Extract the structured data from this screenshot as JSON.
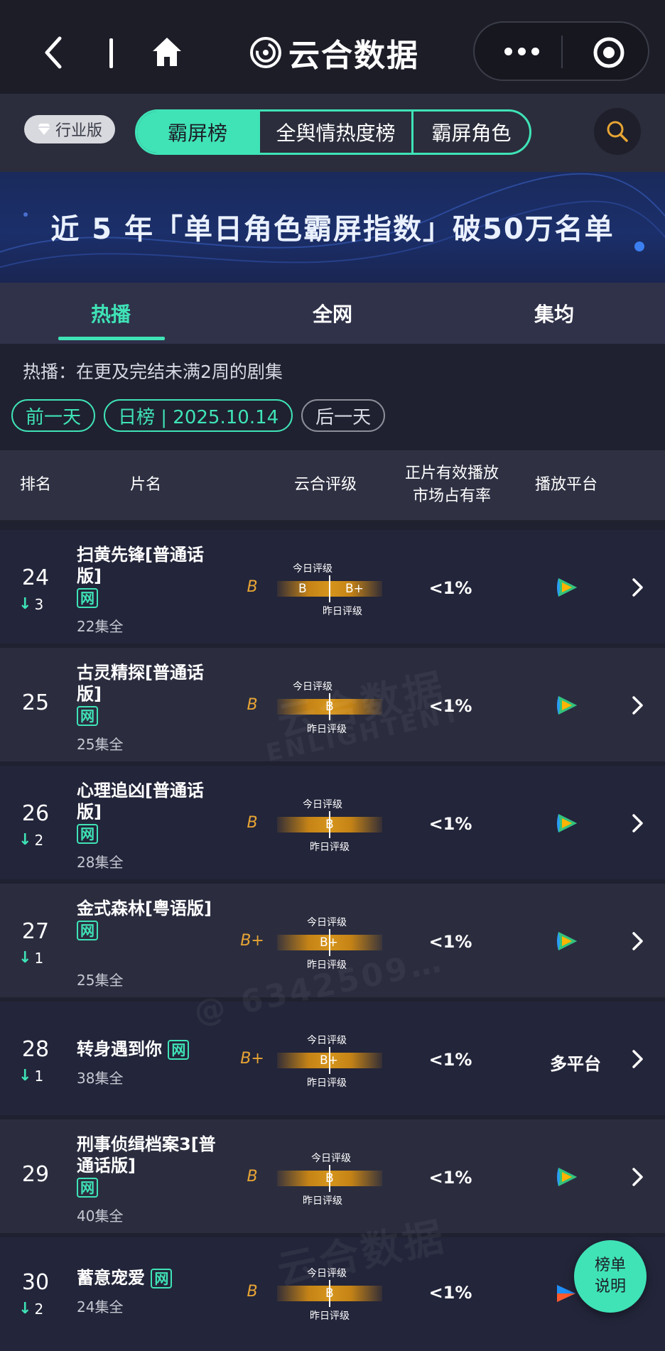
{
  "nav": {
    "title": "云合数据",
    "icons": [
      "back-icon",
      "home-icon",
      "yunhe-logo-icon",
      "more-icon",
      "close-miniprogram-icon"
    ]
  },
  "filter": {
    "edition": "行业版",
    "segments": [
      "霸屏榜",
      "全舆情热度榜",
      "霸屏角色"
    ],
    "active_segment": "霸屏榜"
  },
  "banner": {
    "text": "近 5 年「单日角色霸屏指数」破50万名单"
  },
  "tabs": [
    "热播",
    "全网",
    "集均"
  ],
  "active_tab": "热播",
  "subtitle": "热播：在更及完结未满2周的剧集",
  "date": {
    "prev": "前一天",
    "current": "日榜 | 2025.10.14",
    "next": "后一天"
  },
  "table": {
    "headers": {
      "rank": "排名",
      "title": "片名",
      "grade": "云合评级",
      "share_line1": "正片有效播放",
      "share_line2": "市场占有率",
      "platform": "播放平台"
    },
    "today_label": "今日评级",
    "yesterday_label": "昨日评级",
    "rows": [
      {
        "rank": "24",
        "change": "3",
        "title": "扫黄先锋[普通话版]",
        "episodes": "22集全",
        "grade": "B",
        "today": "B",
        "yesterday": "B+",
        "share": "<1%",
        "platform": "tencent-video-icon"
      },
      {
        "rank": "25",
        "change": "",
        "title": "古灵精探[普通话版]",
        "episodes": "25集全",
        "grade": "B",
        "today": "B",
        "yesterday": "",
        "share": "<1%",
        "platform": "tencent-video-icon"
      },
      {
        "rank": "26",
        "change": "2",
        "title": "心理追凶[普通话版]",
        "episodes": "28集全",
        "grade": "B",
        "today": "B",
        "yesterday": "",
        "share": "<1%",
        "platform": "tencent-video-icon"
      },
      {
        "rank": "27",
        "change": "1",
        "title": "金式森林[粤语版]",
        "episodes": "25集全",
        "grade": "B+",
        "today": "B+",
        "yesterday": "",
        "share": "<1%",
        "platform": "tencent-video-icon"
      },
      {
        "rank": "28",
        "change": "1",
        "title": "转身遇到你",
        "episodes": "38集全",
        "grade": "B+",
        "today": "B+",
        "yesterday": "",
        "share": "<1%",
        "platform_text": "多平台"
      },
      {
        "rank": "29",
        "change": "",
        "title": "刑事侦缉档案3[普通话版]",
        "episodes": "40集全",
        "grade": "B",
        "today": "B",
        "yesterday": "",
        "share": "<1%",
        "platform": "tencent-video-icon"
      },
      {
        "rank": "30",
        "change": "2",
        "title": "蓄意宠爱",
        "episodes": "24集全",
        "grade": "B",
        "today": "B",
        "yesterday": "",
        "share": "<1%",
        "platform": "youku-icon"
      }
    ],
    "wang_badge": "网"
  },
  "watermarks": [
    "云合数据",
    "ENLIGHTENT",
    "@ 6342509…"
  ],
  "float_button": {
    "line1": "榜单",
    "line2": "说明"
  },
  "colors": {
    "accent": "#3fe3b6",
    "grade": "#e8a534",
    "bg": "#1f2130"
  }
}
